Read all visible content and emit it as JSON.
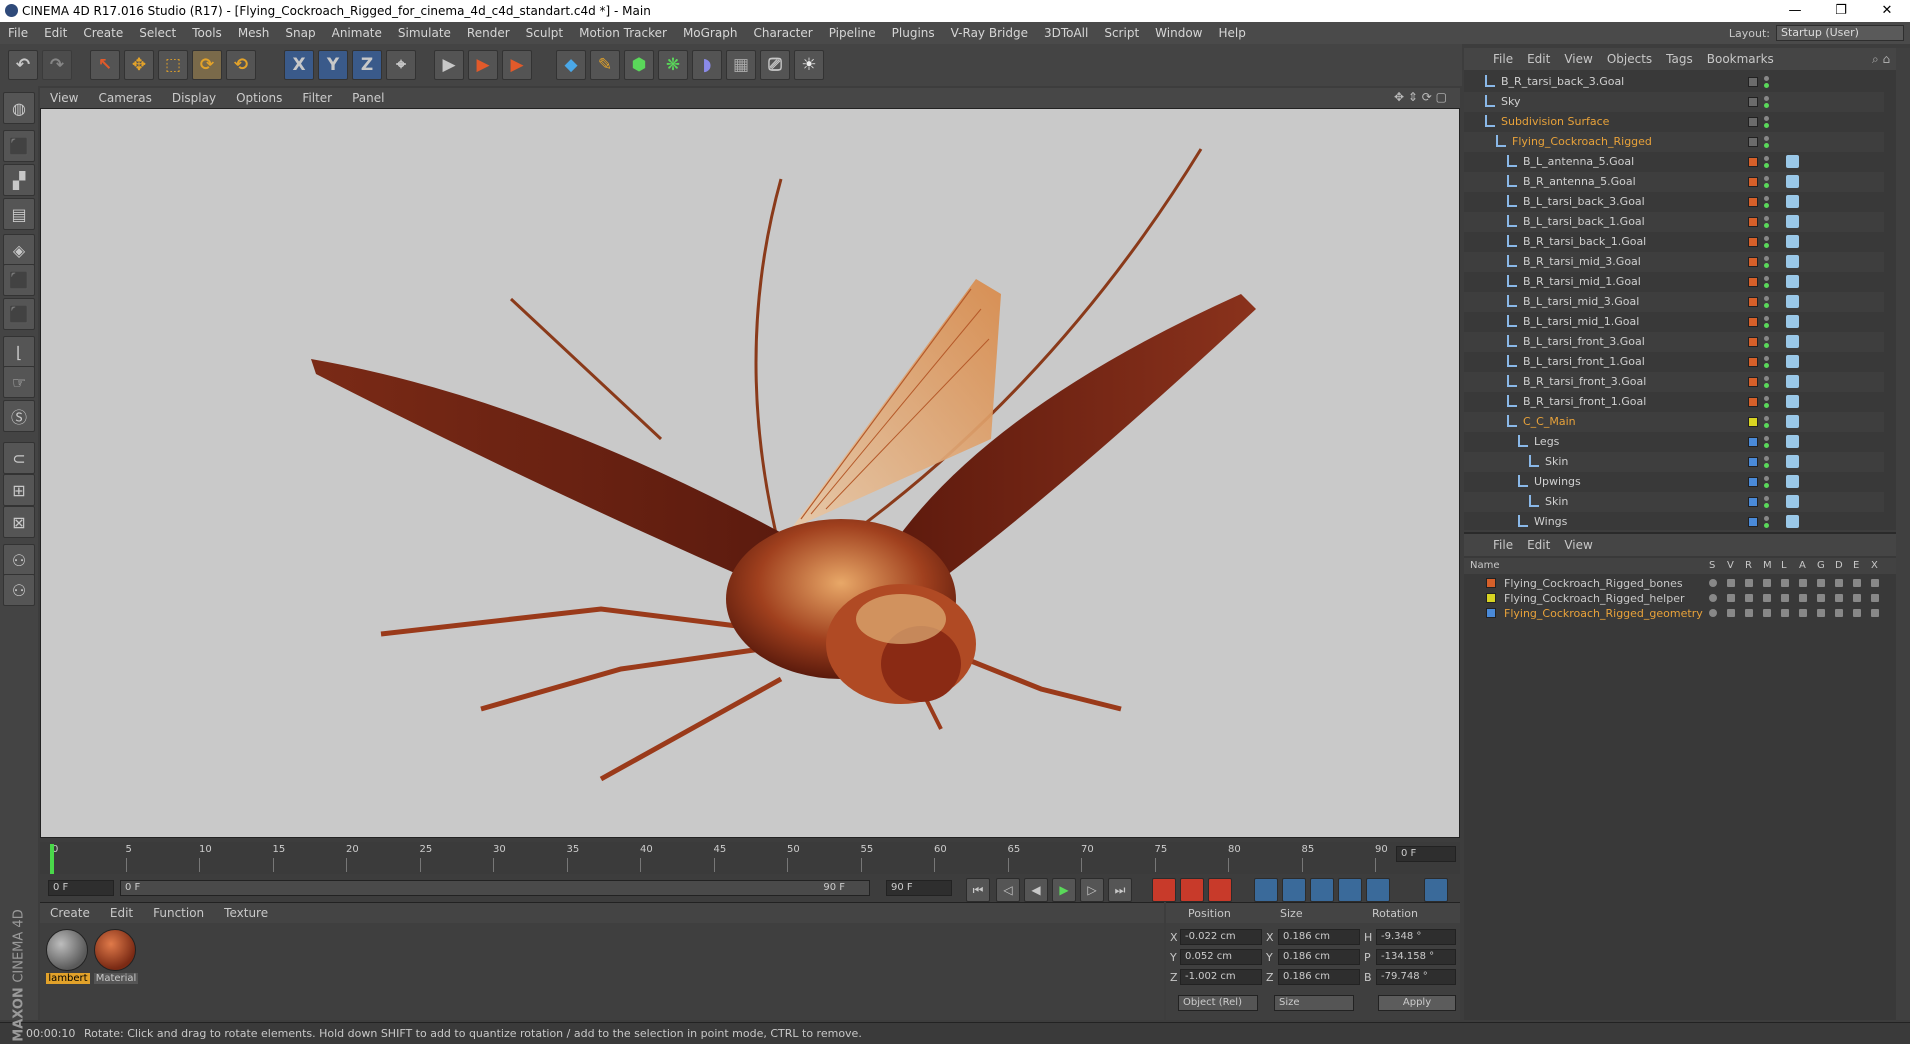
{
  "window": {
    "title": "CINEMA 4D R17.016 Studio (R17) - [Flying_Cockroach_Rigged_for_cinema_4d_c4d_standart.c4d *] - Main",
    "minimize": "—",
    "restore": "❐",
    "close": "✕"
  },
  "menubar": {
    "items": [
      "File",
      "Edit",
      "Create",
      "Select",
      "Tools",
      "Mesh",
      "Snap",
      "Animate",
      "Simulate",
      "Render",
      "Sculpt",
      "Motion Tracker",
      "MoGraph",
      "Character",
      "Pipeline",
      "Plugins",
      "V-Ray Bridge",
      "3DToAll",
      "Script",
      "Window",
      "Help"
    ],
    "layout_label": "Layout:",
    "layout_value": "Startup (User)"
  },
  "toolbar": {
    "undo": "↶",
    "redo": "↷",
    "pointer": "↖",
    "move": "✥",
    "scale": "⬚",
    "rotate": "⟳",
    "rotate2": "⟲",
    "x_axis": "X",
    "y_axis": "Y",
    "z_axis": "Z",
    "coord": "⌖",
    "render1": "▶",
    "render2": "▶",
    "render3": "▶",
    "cube": "◆",
    "pen": "✎",
    "subdiv": "⬢",
    "clone": "❋",
    "deform": "◗",
    "scene": "▦",
    "camera": "⎚",
    "light": "☀"
  },
  "lefttools": [
    "◍",
    "⬛",
    "▞",
    "▤",
    "◈",
    "⬛",
    "⬛",
    "⌊",
    "☞",
    "Ⓢ",
    "⊂",
    "⊞",
    "⊠",
    "⚇",
    "⚇"
  ],
  "viewport_menu": [
    "View",
    "Cameras",
    "Display",
    "Options",
    "Filter",
    "Panel"
  ],
  "timeline": {
    "ticks": [
      "0",
      "5",
      "10",
      "15",
      "20",
      "25",
      "30",
      "35",
      "40",
      "45",
      "50",
      "55",
      "60",
      "65",
      "70",
      "75",
      "80",
      "85",
      "90"
    ],
    "current_frame": "0 F"
  },
  "transport": {
    "start": "0 F",
    "range_start": "0 F",
    "range_end": "90 F",
    "end": "90 F",
    "buttons": [
      "⏮",
      "◁",
      "◀",
      "▶",
      "▷",
      "⏭"
    ]
  },
  "materials": {
    "menu": [
      "Create",
      "Edit",
      "Function",
      "Texture"
    ],
    "items": [
      {
        "name": "lambert",
        "selected": true
      },
      {
        "name": "Material",
        "selected": false
      }
    ]
  },
  "coords": {
    "headers": [
      "Position",
      "Size",
      "Rotation"
    ],
    "rows": [
      {
        "axis": "X",
        "pos": "-0.022 cm",
        "size_axis": "X",
        "size": "0.186 cm",
        "rot_axis": "H",
        "rot": "-9.348 °"
      },
      {
        "axis": "Y",
        "pos": "0.052 cm",
        "size_axis": "Y",
        "size": "0.186 cm",
        "rot_axis": "P",
        "rot": "-134.158 °"
      },
      {
        "axis": "Z",
        "pos": "-1.002 cm",
        "size_axis": "Z",
        "size": "0.186 cm",
        "rot_axis": "B",
        "rot": "-79.748 °"
      }
    ],
    "mode": "Object (Rel)",
    "size_mode": "Size",
    "apply": "Apply"
  },
  "status": {
    "time": "00:00:10",
    "message": "Rotate: Click and drag to rotate elements. Hold down SHIFT to add to quantize rotation / add to the selection in point mode, CTRL to remove."
  },
  "object_manager": {
    "menu": [
      "File",
      "Edit",
      "View",
      "Objects",
      "Tags",
      "Bookmarks"
    ],
    "rows": [
      {
        "name": "B_R_tarsi_back_3.Goal",
        "indent": 1,
        "color": "#6b6b6b",
        "highlight": false
      },
      {
        "name": "Sky",
        "indent": 1,
        "color": "#6b6b6b",
        "highlight": false
      },
      {
        "name": "Subdivision Surface",
        "indent": 1,
        "color": "#6b6b6b",
        "highlight": true
      },
      {
        "name": "Flying_Cockroach_Rigged",
        "indent": 2,
        "color": "#6b6b6b",
        "highlight": true
      },
      {
        "name": "B_L_antenna_5.Goal",
        "indent": 3,
        "color": "#d6602a",
        "highlight": false
      },
      {
        "name": "B_R_antenna_5.Goal",
        "indent": 3,
        "color": "#d6602a",
        "highlight": false
      },
      {
        "name": "B_L_tarsi_back_3.Goal",
        "indent": 3,
        "color": "#d6602a",
        "highlight": false
      },
      {
        "name": "B_L_tarsi_back_1.Goal",
        "indent": 3,
        "color": "#d6602a",
        "highlight": false
      },
      {
        "name": "B_R_tarsi_back_1.Goal",
        "indent": 3,
        "color": "#d6602a",
        "highlight": false
      },
      {
        "name": "B_R_tarsi_mid_3.Goal",
        "indent": 3,
        "color": "#d6602a",
        "highlight": false
      },
      {
        "name": "B_R_tarsi_mid_1.Goal",
        "indent": 3,
        "color": "#d6602a",
        "highlight": false
      },
      {
        "name": "B_L_tarsi_mid_3.Goal",
        "indent": 3,
        "color": "#d6602a",
        "highlight": false
      },
      {
        "name": "B_L_tarsi_mid_1.Goal",
        "indent": 3,
        "color": "#d6602a",
        "highlight": false
      },
      {
        "name": "B_L_tarsi_front_3.Goal",
        "indent": 3,
        "color": "#d6602a",
        "highlight": false
      },
      {
        "name": "B_L_tarsi_front_1.Goal",
        "indent": 3,
        "color": "#d6602a",
        "highlight": false
      },
      {
        "name": "B_R_tarsi_front_3.Goal",
        "indent": 3,
        "color": "#d6602a",
        "highlight": false
      },
      {
        "name": "B_R_tarsi_front_1.Goal",
        "indent": 3,
        "color": "#d6602a",
        "highlight": false
      },
      {
        "name": "C_C_Main",
        "indent": 3,
        "color": "#d8d422",
        "highlight": true
      },
      {
        "name": "Legs",
        "indent": 4,
        "color": "#4a8ad8",
        "highlight": false
      },
      {
        "name": "Skin",
        "indent": 5,
        "color": "#4a8ad8",
        "highlight": false
      },
      {
        "name": "Upwings",
        "indent": 4,
        "color": "#4a8ad8",
        "highlight": false
      },
      {
        "name": "Skin",
        "indent": 5,
        "color": "#4a8ad8",
        "highlight": false
      },
      {
        "name": "Wings",
        "indent": 4,
        "color": "#4a8ad8",
        "highlight": false
      }
    ]
  },
  "layer_manager": {
    "menu": [
      "File",
      "Edit",
      "View"
    ],
    "columns": [
      "Name",
      "S",
      "V",
      "R",
      "M",
      "L",
      "A",
      "G",
      "D",
      "E",
      "X"
    ],
    "rows": [
      {
        "name": "Flying_Cockroach_Rigged_bones",
        "color": "#d6602a",
        "highlight": false
      },
      {
        "name": "Flying_Cockroach_Rigged_helper",
        "color": "#d8d422",
        "highlight": false
      },
      {
        "name": "Flying_Cockroach_Rigged_geometry",
        "color": "#4a8ad8",
        "highlight": true
      }
    ]
  },
  "logo": {
    "brand": "MAXON",
    "product": "CINEMA 4D"
  }
}
